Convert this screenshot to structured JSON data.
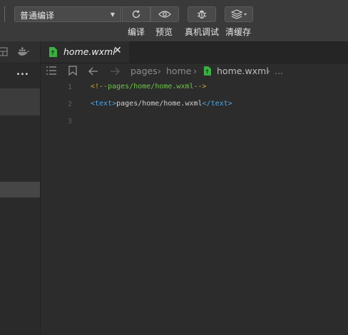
{
  "toolbar": {
    "compile_mode": "普通编译",
    "buttons": [
      {
        "label": "编译",
        "icon": "refresh-icon"
      },
      {
        "label": "预览",
        "icon": "eye-icon"
      },
      {
        "label": "真机调试",
        "icon": "bug-icon"
      },
      {
        "label": "清缓存",
        "icon": "layers-icon"
      }
    ]
  },
  "sidebar": {
    "more": "..."
  },
  "editor_tab": {
    "title": "home.wxml",
    "close": "✕"
  },
  "breadcrumb": {
    "items": [
      "pages",
      "home",
      "home.wxml",
      "..."
    ]
  },
  "code": {
    "line_numbers": [
      "1",
      "2",
      "3"
    ],
    "line1": {
      "open": "<!--",
      "text": "pages/home/home.wxml",
      "close": "-->"
    },
    "line2": {
      "open_tag": "<text>",
      "text": "pages/home/home.wxml",
      "close_tag": "</text>"
    }
  },
  "colors": {
    "background": "#2c2c2c",
    "toolbar": "#3a3a3a",
    "comment": "#6cc644",
    "tag": "#4fa6e8",
    "file_icon": "#3cb043"
  }
}
